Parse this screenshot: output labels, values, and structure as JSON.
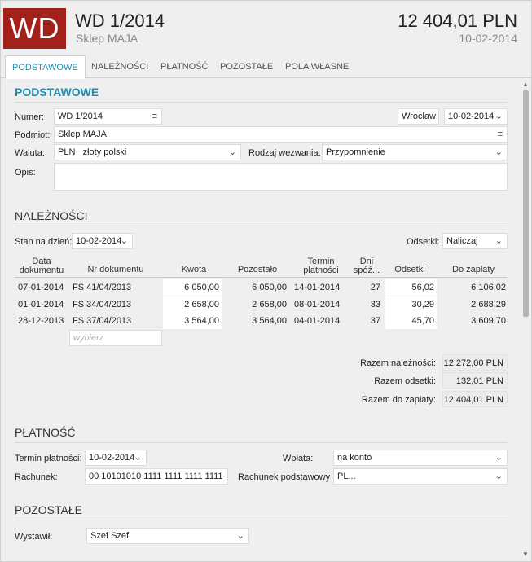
{
  "header": {
    "logo_text": "WD",
    "doc_number": "WD 1/2014",
    "client": "Sklep MAJA",
    "total": "12 404,01 PLN",
    "date": "10-02-2014"
  },
  "tabs": [
    {
      "label": "PODSTAWOWE",
      "active": true
    },
    {
      "label": "NALEŻNOŚCI"
    },
    {
      "label": "PŁATNOŚĆ"
    },
    {
      "label": "POZOSTAŁE"
    },
    {
      "label": "POLA WŁASNE"
    }
  ],
  "basic": {
    "title": "PODSTAWOWE",
    "number_label": "Numer:",
    "number_value": "WD 1/2014",
    "city_value": "Wrocław",
    "date_value": "10-02-2014",
    "entity_label": "Podmiot:",
    "entity_value": "Sklep MAJA",
    "currency_label": "Waluta:",
    "currency_code": "PLN",
    "currency_name": "złoty polski",
    "notice_label": "Rodzaj wezwania:",
    "notice_value": "Przypomnienie",
    "description_label": "Opis:",
    "description_value": ""
  },
  "receivables": {
    "title": "NALEŻNOŚCI",
    "as_of_label": "Stan na dzień:",
    "as_of_value": "10-02-2014",
    "interest_label": "Odsetki:",
    "interest_value": "Naliczaj",
    "columns": {
      "date_l1": "Data",
      "date_l2": "dokumentu",
      "doc": "Nr dokumentu",
      "amount": "Kwota",
      "remaining": "Pozostało",
      "due_l1": "Termin",
      "due_l2": "płatności",
      "days_l1": "Dni",
      "days_l2": "spóź...",
      "interest": "Odsetki",
      "to_pay": "Do zapłaty"
    },
    "rows": [
      {
        "date": "07-01-2014",
        "doc": "FS 41/04/2013",
        "amount": "6 050,00",
        "remaining": "6 050,00",
        "due": "14-01-2014",
        "days": "27",
        "interest": "56,02",
        "to_pay": "6 106,02"
      },
      {
        "date": "01-01-2014",
        "doc": "FS 34/04/2013",
        "amount": "2 658,00",
        "remaining": "2 658,00",
        "due": "08-01-2014",
        "days": "33",
        "interest": "30,29",
        "to_pay": "2 688,29"
      },
      {
        "date": "28-12-2013",
        "doc": "FS 37/04/2013",
        "amount": "3 564,00",
        "remaining": "3 564,00",
        "due": "04-01-2014",
        "days": "37",
        "interest": "45,70",
        "to_pay": "3 609,70"
      }
    ],
    "add_placeholder": "wybierz",
    "sum_receivables_label": "Razem należności:",
    "sum_receivables_value": "12 272,00 PLN",
    "sum_interest_label": "Razem odsetki:",
    "sum_interest_value": "132,01 PLN",
    "sum_to_pay_label": "Razem do zapłaty:",
    "sum_to_pay_value": "12 404,01 PLN"
  },
  "payment": {
    "title": "PŁATNOŚĆ",
    "due_label": "Termin płatności:",
    "due_value": "10-02-2014",
    "deposit_label": "Wpłata:",
    "deposit_value": "na konto",
    "account_label": "Rachunek:",
    "account_value": "00 10101010 1111 1111 1111 1111",
    "main_account_label": "Rachunek podstawowy",
    "main_account_value": "PL..."
  },
  "other": {
    "title": "POZOSTAŁE",
    "issuer_label": "Wystawił:",
    "issuer_value": "Szef Szef"
  },
  "colors": {
    "accent": "#1a8fb3",
    "logo": "#a3211b"
  }
}
